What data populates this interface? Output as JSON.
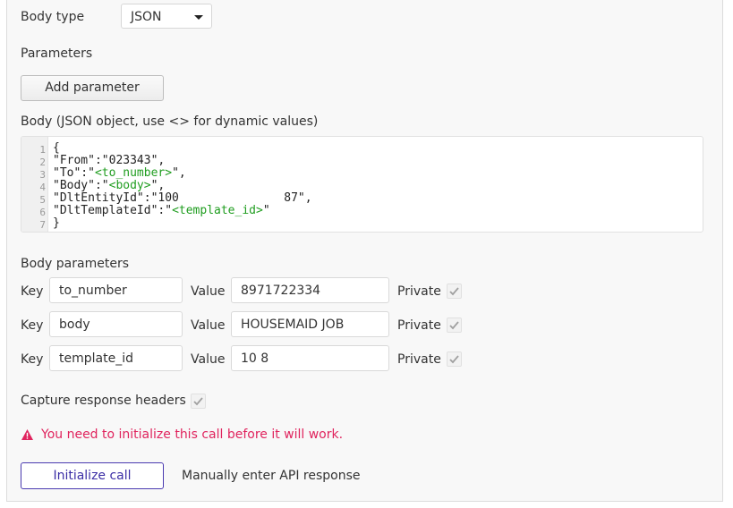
{
  "body_type": {
    "label": "Body type",
    "value": "JSON"
  },
  "parameters": {
    "label": "Parameters",
    "add_button": "Add parameter"
  },
  "body": {
    "label": "Body (JSON object, use <> for dynamic values)",
    "line_numbers": [
      "1",
      "2",
      "3",
      "4",
      "5",
      "6",
      "7"
    ],
    "lines": [
      [
        {
          "t": "{",
          "dyn": false
        }
      ],
      [
        {
          "t": "\"From\":\"023343\",",
          "dyn": false
        }
      ],
      [
        {
          "t": "\"To\":\"",
          "dyn": false
        },
        {
          "t": "<to_number>",
          "dyn": true
        },
        {
          "t": "\",",
          "dyn": false
        }
      ],
      [
        {
          "t": "\"Body\":\"",
          "dyn": false
        },
        {
          "t": "<body>",
          "dyn": true
        },
        {
          "t": "\",",
          "dyn": false
        }
      ],
      [
        {
          "t": "\"DltEntityId\":\"100               87\",",
          "dyn": false
        }
      ],
      [
        {
          "t": "\"DltTemplateId\":\"",
          "dyn": false
        },
        {
          "t": "<template_id>",
          "dyn": true
        },
        {
          "t": "\"",
          "dyn": false
        }
      ],
      [
        {
          "t": "}",
          "dyn": false
        }
      ]
    ]
  },
  "body_parameters": {
    "label": "Body parameters",
    "key_label": "Key",
    "value_label": "Value",
    "private_label": "Private",
    "rows": [
      {
        "key": "to_number",
        "value": "8971722334",
        "private": true
      },
      {
        "key": "body",
        "value": "HOUSEMAID JOB",
        "private": true
      },
      {
        "key": "template_id",
        "value": "10          8",
        "private": true
      }
    ]
  },
  "capture_headers": {
    "label": "Capture response headers",
    "checked": true
  },
  "warning": {
    "text": "You need to initialize this call before it will work.",
    "color": "#e0245e"
  },
  "actions": {
    "initialize": "Initialize call",
    "manual": "Manually enter API response"
  },
  "colors": {
    "accent": "#3b2ea5",
    "dynamic": "#1f9d1f"
  }
}
